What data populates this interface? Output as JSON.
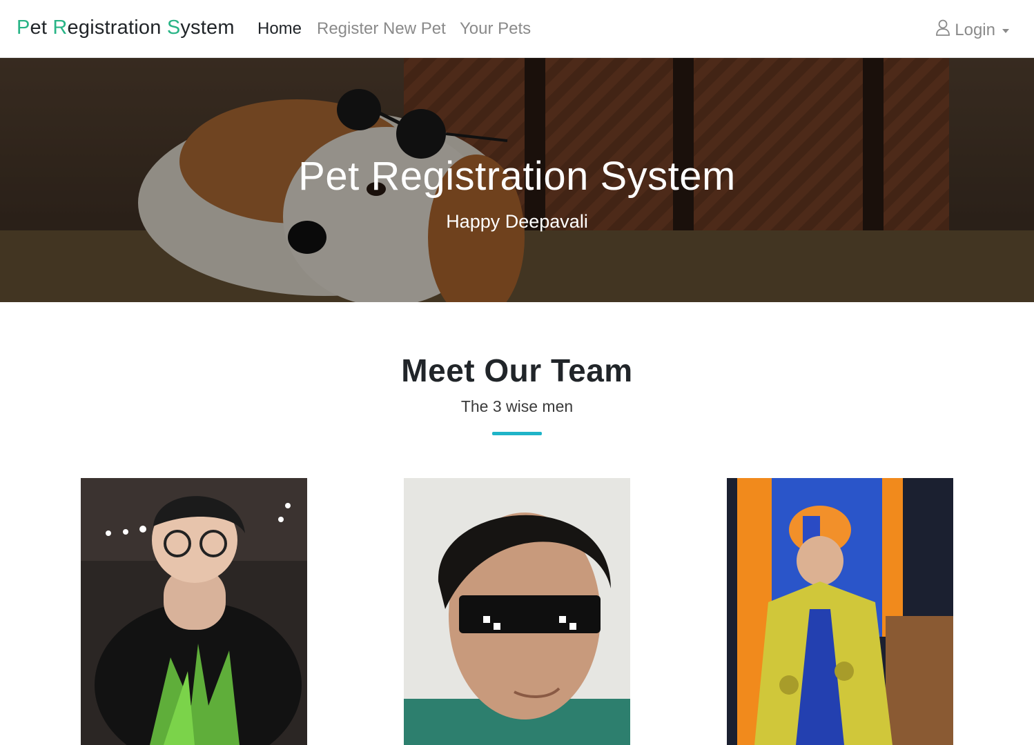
{
  "navbar": {
    "brand": {
      "parts": [
        {
          "text": "P",
          "accent": true
        },
        {
          "text": "et ",
          "accent": false
        },
        {
          "text": "R",
          "accent": true
        },
        {
          "text": "egistration ",
          "accent": false
        },
        {
          "text": "S",
          "accent": true
        },
        {
          "text": "ystem",
          "accent": false
        }
      ]
    },
    "links": [
      {
        "label": "Home",
        "active": true
      },
      {
        "label": "Register New Pet",
        "active": false
      },
      {
        "label": "Your Pets",
        "active": false
      }
    ],
    "login_label": "Login",
    "accent_color": "#28b486"
  },
  "hero": {
    "title": "Pet Registration System",
    "subtitle": "Happy Deepavali"
  },
  "team": {
    "title": "Meet Our Team",
    "subtitle": "The 3 wise men",
    "divider_color": "#1fb4c8"
  }
}
